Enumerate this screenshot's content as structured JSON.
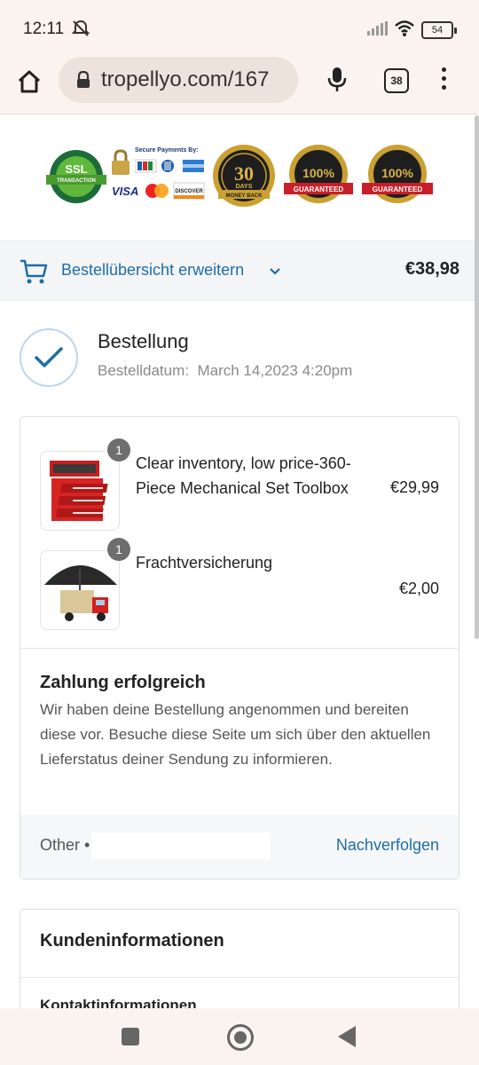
{
  "status_bar": {
    "time": "12:11",
    "battery": "54"
  },
  "browser": {
    "url": "tropellyo.com/167",
    "tab_count": "38"
  },
  "badges": {
    "ssl": "SSL",
    "ssl_sub": "TRANSACTION",
    "secure_payments": "Secure Payments By:",
    "money_back_number": "30",
    "money_back_days": "DAYS",
    "money_back_label": "MONEY BACK",
    "best_price": "100%",
    "best_price_label": "GUARANTEED",
    "satisfaction": "100%",
    "satisfaction_label": "GUARANTEED"
  },
  "summary": {
    "label": "Bestellübersicht erweitern",
    "total": "€38,98"
  },
  "order": {
    "title": "Bestellung",
    "date_label": "Bestelldatum:",
    "date_value": "March 14,2023 4:20pm"
  },
  "items": [
    {
      "qty": "1",
      "name": "Clear inventory, low price-360-Piece Mechanical Set Toolbox",
      "price": "€29,99"
    },
    {
      "qty": "1",
      "name": "Frachtversicherung",
      "price": "€2,00"
    }
  ],
  "payment": {
    "title": "Zahlung erfolgreich",
    "text": "Wir haben deine Bestellung angenommen und bereiten diese vor. Besuche diese Seite um sich über den aktuellen Lieferstatus deiner Sendung zu informieren."
  },
  "tracking": {
    "carrier": "Other •",
    "link": "Nachverfolgen"
  },
  "customer": {
    "title": "Kundeninformationen",
    "subtitle": "Kontaktinformationen"
  },
  "colors": {
    "accent": "#1f6da8",
    "chrome": "#fbf3ef"
  }
}
